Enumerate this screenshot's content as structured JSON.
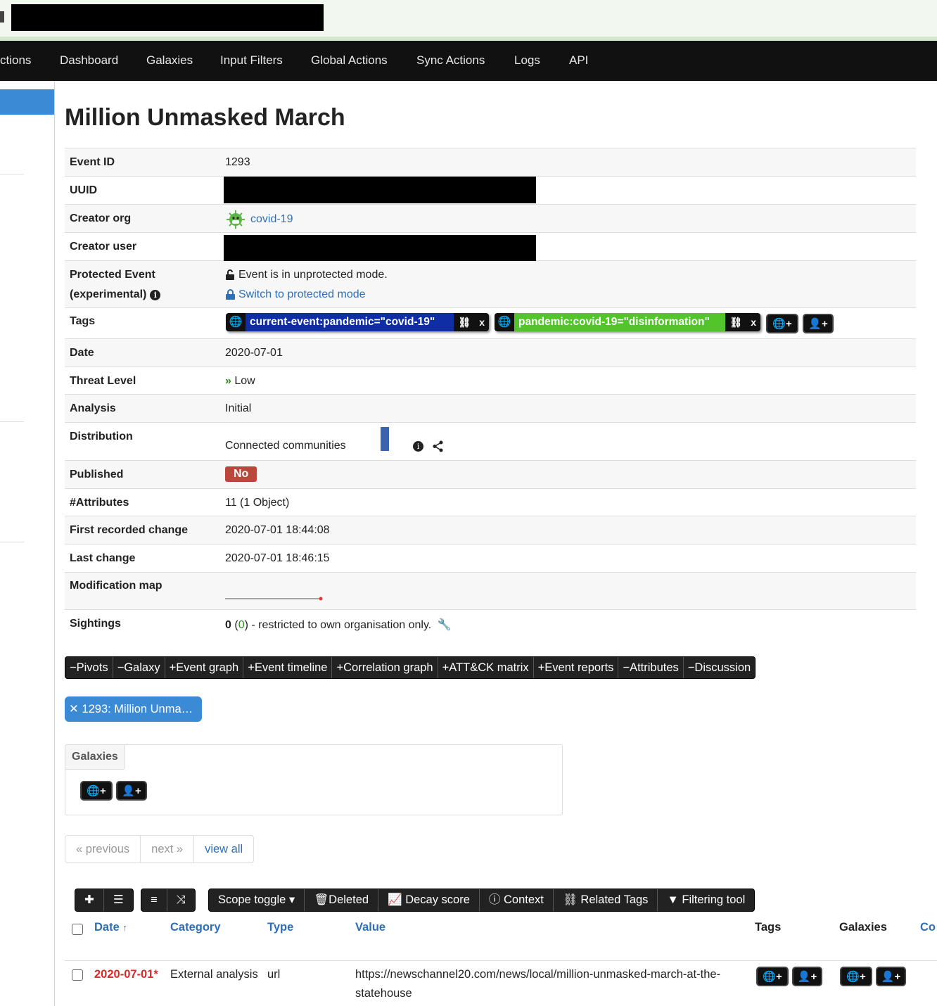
{
  "nav": {
    "items": [
      "ctions",
      "Dashboard",
      "Galaxies",
      "Input Filters",
      "Global Actions",
      "Sync Actions",
      "Logs",
      "API"
    ]
  },
  "event": {
    "title": "Million Unmasked March",
    "rows": {
      "event_id": {
        "label": "Event ID",
        "value": "1293"
      },
      "uuid": {
        "label": "UUID"
      },
      "creator_org": {
        "label": "Creator org",
        "value": "covid-19"
      },
      "creator_user": {
        "label": "Creator user"
      },
      "protected": {
        "label1": "Protected Event",
        "label2": "(experimental)",
        "status": "Event is in unprotected mode.",
        "switch_link": "Switch to protected mode"
      },
      "tags": {
        "label": "Tags"
      },
      "date": {
        "label": "Date",
        "value": "2020-07-01"
      },
      "threat_level": {
        "label": "Threat Level",
        "value": "Low"
      },
      "analysis": {
        "label": "Analysis",
        "value": "Initial"
      },
      "distribution": {
        "label": "Distribution",
        "value": "Connected communities"
      },
      "published": {
        "label": "Published",
        "value": "No"
      },
      "attributes": {
        "label": "#Attributes",
        "value": "11 (1 Object)"
      },
      "first_change": {
        "label": "First recorded change",
        "value": "2020-07-01 18:44:08"
      },
      "last_change": {
        "label": "Last change",
        "value": "2020-07-01 18:46:15"
      },
      "modification_map": {
        "label": "Modification map"
      },
      "sightings": {
        "label": "Sightings",
        "count": "0",
        "open": " (",
        "inner": "0",
        "suffix": ") - restricted to own organisation only."
      }
    }
  },
  "tags": [
    {
      "name": "current-event:pandemic=\"covid-19\"",
      "color": "#0f2ea6",
      "action": "x"
    },
    {
      "name": "pandemic:covid-19=\"disinformation\"",
      "color": "#52c52a",
      "action": "x"
    }
  ],
  "toggles": [
    "Pivots",
    "Galaxy",
    "Event graph",
    "Event timeline",
    "Correlation graph",
    "ATT&CK matrix",
    "Event reports",
    "Attributes",
    "Discussion"
  ],
  "toggle_signs": [
    "−",
    "−",
    "+",
    "+",
    "+",
    "+",
    "+",
    "−",
    "−"
  ],
  "pivot_pill": "1293: Million Unma…",
  "galaxies_label": "Galaxies",
  "pager": {
    "previous": "« previous",
    "next": "next »",
    "view_all": "view all"
  },
  "toolbar": {
    "scope_toggle": "Scope toggle",
    "deleted": "Deleted",
    "decay_score": "Decay score",
    "context": "Context",
    "related_tags": "Related Tags",
    "filtering_tool": "Filtering tool"
  },
  "attr_table": {
    "headers": {
      "date": "Date",
      "category": "Category",
      "type": "Type",
      "value": "Value",
      "tags": "Tags",
      "galaxies": "Galaxies",
      "extra": "Co"
    },
    "rows": [
      {
        "date": "2020-07-01*",
        "category": "External analysis",
        "type": "url",
        "value_line1": "https://newschannel20.com/news/local/million-unmasked-march-at-the-",
        "value_line2": "statehouse"
      }
    ]
  }
}
